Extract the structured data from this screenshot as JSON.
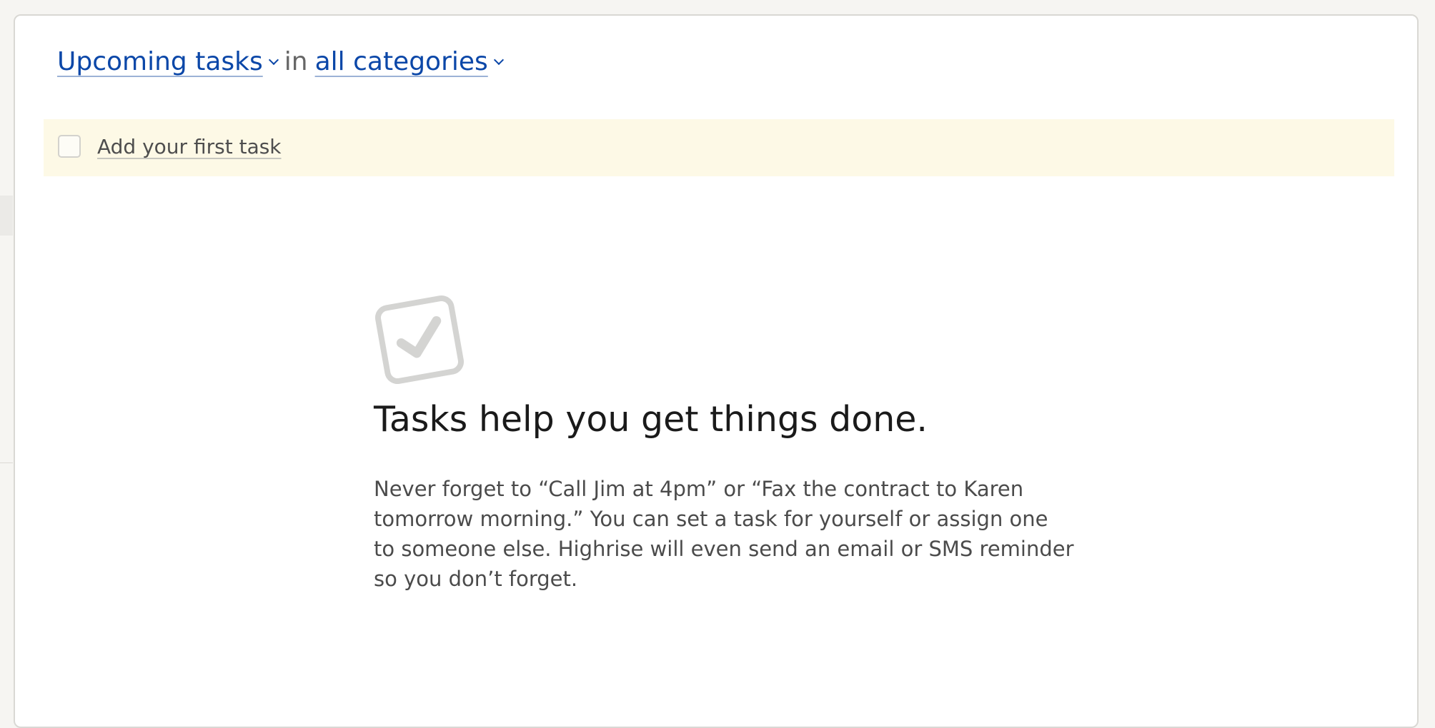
{
  "header": {
    "view_label": "Upcoming tasks",
    "connector": "in",
    "category_label": "all categories"
  },
  "add_task": {
    "label": "Add your first task"
  },
  "empty_state": {
    "icon": "checkbox-check-icon",
    "title": "Tasks help you get things done.",
    "description": "Never forget to “Call Jim at 4pm” or “Fax the contract to Karen tomorrow morning.” You can set a task for yourself or assign one to someone else. Highrise will even send an email or SMS reminder so you don’t forget."
  },
  "colors": {
    "link": "#0b47a8",
    "add_row_bg": "#fdf9e6",
    "page_bg": "#f6f5f2"
  }
}
